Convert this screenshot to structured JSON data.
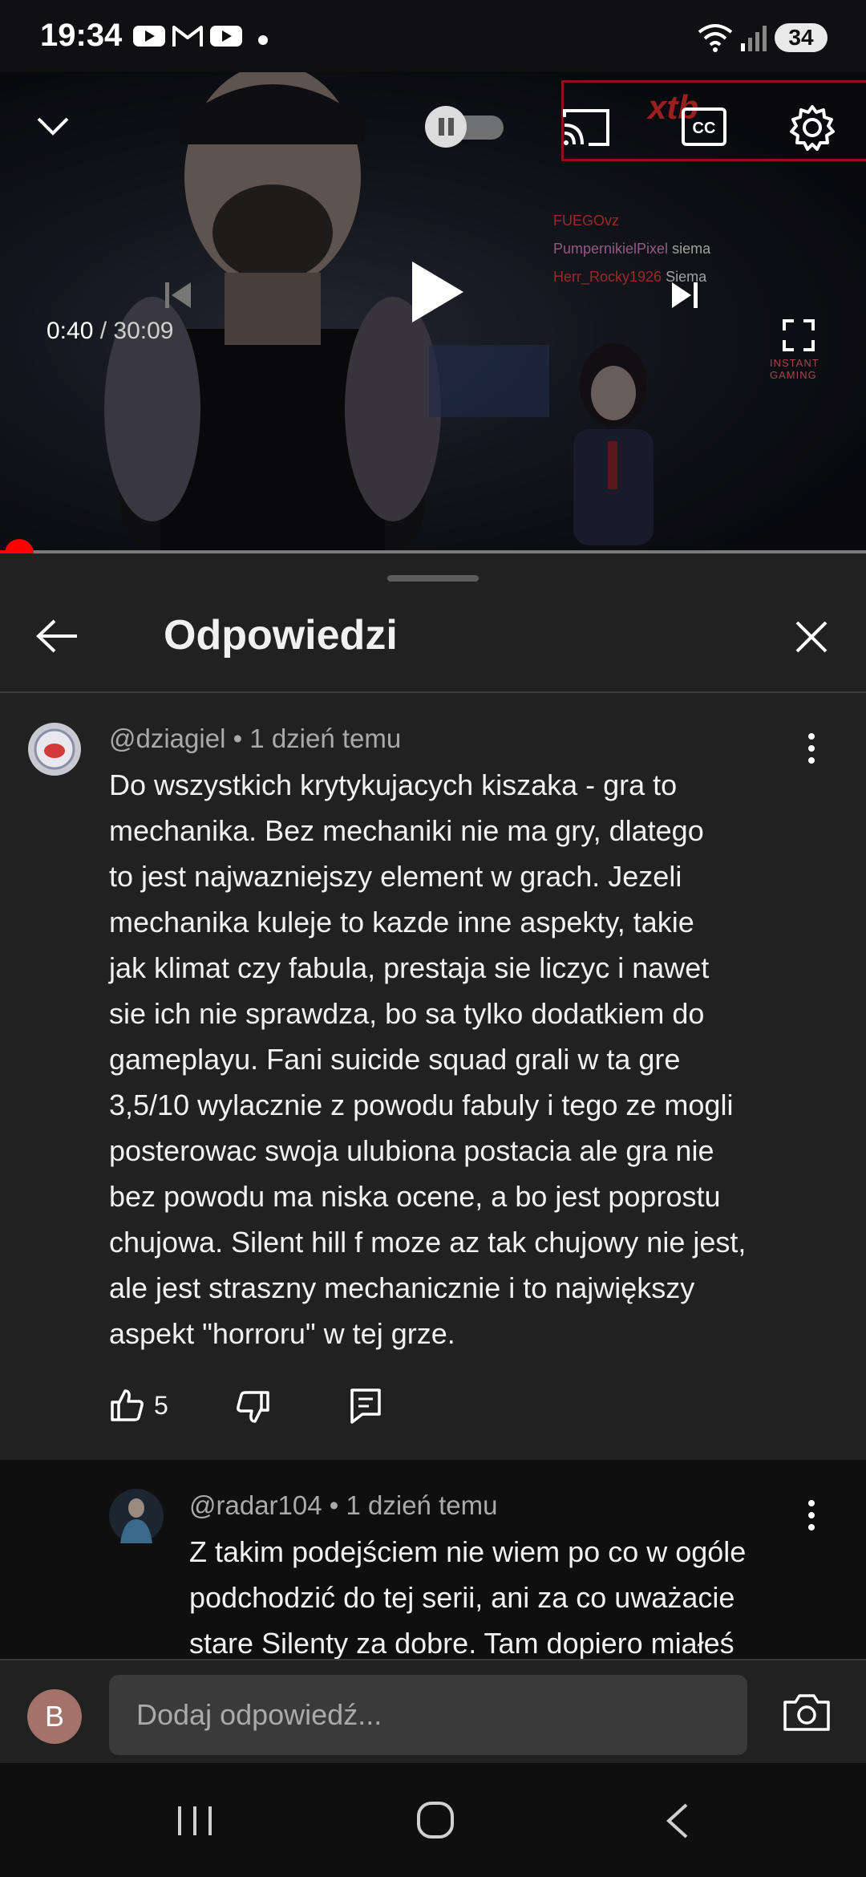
{
  "status_bar": {
    "time": "19:34",
    "notification_icons": [
      "youtube-icon",
      "gmail-icon",
      "youtube-icon",
      "dot-icon"
    ],
    "battery": "34"
  },
  "player": {
    "current_time": "0:40",
    "separator": " / ",
    "duration": "30:09",
    "progress_fraction": 0.022,
    "overlay_brand": "xtb",
    "overlay_corner": "INSTANT GAMING",
    "stream_chat": [
      {
        "user": "FUEGOvz",
        "message": ""
      },
      {
        "user": "PumpernikielPixel",
        "message": "siema"
      },
      {
        "user": "Herr_Rocky1926",
        "message": "Siema"
      }
    ]
  },
  "sheet": {
    "title": "Odpowiedzi"
  },
  "comments": [
    {
      "author": "@dziagiel",
      "time": "1 dzień temu",
      "text": [
        "Do wszystkich krytykujacych kiszaka - gra to",
        "mechanika. Bez mechaniki nie ma gry, dlatego",
        "to jest najwazniejszy element w grach. Jezeli",
        "mechanika kuleje to kazde inne aspekty, takie",
        "jak klimat czy fabula, prestaja sie liczyc i nawet",
        "sie ich nie sprawdza, bo sa tylko dodatkiem do",
        "gameplayu. Fani suicide squad grali w ta gre",
        "3,5/10 wylacznie z powodu fabuly i tego ze mogli",
        "posterowac swoja ulubiona postacia ale gra nie",
        "bez powodu ma niska ocene, a bo jest poprostu",
        "chujowa. Silent hill f moze az tak chujowy nie jest,",
        "ale jest straszny mechanicznie i to największy",
        "aspekt \"horroru\" w tej grze."
      ],
      "likes": "5"
    },
    {
      "author": "@radar104",
      "time": "1 dzień temu",
      "text": [
        "Z takim podejściem nie wiem po co w ogóle",
        "podchodzić do tej serii, ani za co uważacie",
        "stare Silenty za dobre. Tam dopiero miałeś"
      ]
    }
  ],
  "meta_separator": " • ",
  "reply_input": {
    "avatar_letter": "B",
    "placeholder": "Dodaj odpowiedź..."
  },
  "colors": {
    "accent": "#ff0000",
    "sheet_bg": "#212121",
    "avatar_b": "#a5726a"
  }
}
